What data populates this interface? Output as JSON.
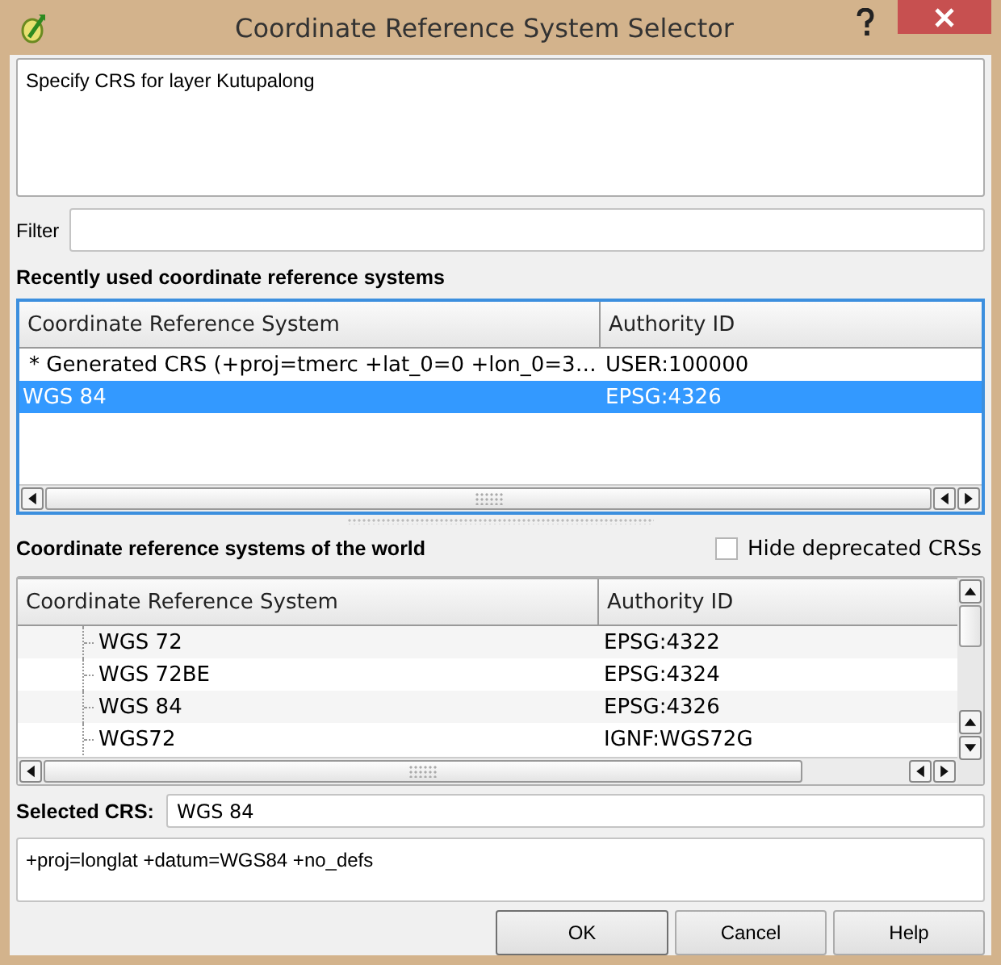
{
  "window": {
    "title": "Coordinate Reference System Selector"
  },
  "description": "Specify CRS for layer Kutupalong",
  "filter": {
    "label": "Filter"
  },
  "recent": {
    "heading": "Recently used coordinate reference systems",
    "columns": [
      "Coordinate Reference System",
      "Authority ID"
    ],
    "rows": [
      {
        "crs": "* Generated CRS (+proj=tmerc +lat_0=0 +lon_0=3…",
        "authority_id": "USER:100000",
        "selected": false
      },
      {
        "crs": "WGS 84",
        "authority_id": "EPSG:4326",
        "selected": true
      }
    ]
  },
  "world": {
    "heading": "Coordinate reference systems of the world",
    "hide_deprecated": {
      "label": "Hide deprecated CRSs",
      "checked": false
    },
    "columns": [
      "Coordinate Reference System",
      "Authority ID"
    ],
    "rows": [
      {
        "crs": "WGS 72",
        "authority_id": "EPSG:4322",
        "selected": false
      },
      {
        "crs": "WGS 72BE",
        "authority_id": "EPSG:4324",
        "selected": false
      },
      {
        "crs": "WGS 84",
        "authority_id": "EPSG:4326",
        "selected": false
      },
      {
        "crs": "WGS72",
        "authority_id": "IGNF:WGS72G",
        "selected": false
      }
    ]
  },
  "selected_crs": {
    "label": "Selected CRS:",
    "value": "WGS 84"
  },
  "proj_string": "+proj=longlat +datum=WGS84 +no_defs",
  "buttons": [
    {
      "label": "OK",
      "default": true
    },
    {
      "label": "Cancel",
      "default": false
    },
    {
      "label": "Help",
      "default": false
    }
  ]
}
